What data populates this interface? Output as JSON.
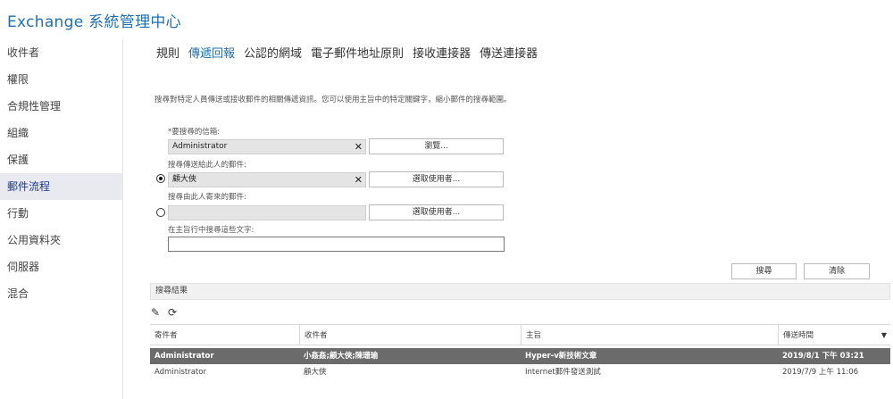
{
  "app": {
    "title": "Exchange 系統管理中心"
  },
  "sidebar": {
    "items": [
      {
        "label": "收件者"
      },
      {
        "label": "權限"
      },
      {
        "label": "合規性管理"
      },
      {
        "label": "組織"
      },
      {
        "label": "保護"
      },
      {
        "label": "郵件流程"
      },
      {
        "label": "行動"
      },
      {
        "label": "公用資料夾"
      },
      {
        "label": "伺服器"
      },
      {
        "label": "混合"
      }
    ],
    "active_index": 5
  },
  "tabs": [
    {
      "label": "規則"
    },
    {
      "label": "傳遞回報"
    },
    {
      "label": "公認的網域"
    },
    {
      "label": "電子郵件地址原則"
    },
    {
      "label": "接收連接器"
    },
    {
      "label": "傳送連接器"
    }
  ],
  "active_tab": 1,
  "form": {
    "description": "搜尋對特定人員傳送或接收郵件的相關傳遞資訊。您可以使用主旨中的特定關鍵字，縮小郵件的搜尋範圍。",
    "mailbox_label": "*要搜尋的信箱:",
    "mailbox_value": "Administrator",
    "browse_button": "瀏覽...",
    "sent_to_label": "搜尋傳送給此人的郵件:",
    "sent_to_value": "顧大俠",
    "select_user_button_1": "選取使用者...",
    "sent_from_label": "搜尋由此人寄來的郵件:",
    "sent_from_value": "",
    "select_user_button_2": "選取使用者...",
    "subject_label": "在主旨行中搜尋這些文字:",
    "subject_value": "",
    "clear_glyph": "✕",
    "search_button": "搜尋",
    "clear_button": "清除"
  },
  "results": {
    "header": "搜尋結果",
    "icons": [
      "edit-icon",
      "refresh-icon"
    ],
    "columns": [
      "寄件者",
      "收件者",
      "主旨",
      "傳送時間"
    ],
    "sort_glyph": "▼",
    "rows": [
      {
        "sender": "Administrator",
        "recipient": "小姦姦;顧大俠;陳珊瑜",
        "subject": "Hyper-v新技術文章",
        "time": "2019/8/1 下午 03:21",
        "selected": true
      },
      {
        "sender": "Administrator",
        "recipient": "顧大俠",
        "subject": "Internet郵件發送測試",
        "time": "2019/7/9 上午 11:06",
        "selected": false
      }
    ]
  },
  "colors": {
    "accent": "#1f6fb2",
    "selected_row": "#6b6b6b",
    "active_sidebar": "#e8eaf0"
  }
}
